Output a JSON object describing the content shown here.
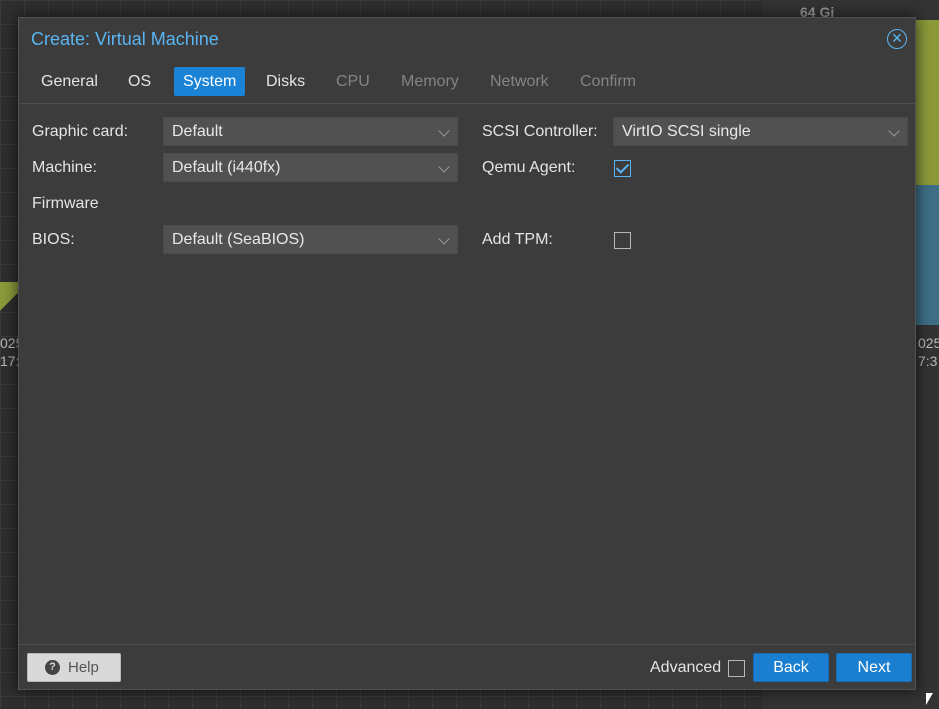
{
  "background": {
    "top_label": "64 Gi",
    "left_year": [
      "025",
      "17:"
    ],
    "right_year": [
      "025",
      "7:3"
    ]
  },
  "dialog": {
    "title": "Create: Virtual Machine",
    "close_icon": "close-circle-icon"
  },
  "tabs": [
    {
      "label": "General",
      "state": "normal"
    },
    {
      "label": "OS",
      "state": "normal"
    },
    {
      "label": "System",
      "state": "active"
    },
    {
      "label": "Disks",
      "state": "normal"
    },
    {
      "label": "CPU",
      "state": "disabled"
    },
    {
      "label": "Memory",
      "state": "disabled"
    },
    {
      "label": "Network",
      "state": "disabled"
    },
    {
      "label": "Confirm",
      "state": "disabled"
    }
  ],
  "form": {
    "graphic_card": {
      "label": "Graphic card:",
      "value": "Default"
    },
    "machine": {
      "label": "Machine:",
      "value": "Default (i440fx)"
    },
    "firmware_heading": "Firmware",
    "bios": {
      "label": "BIOS:",
      "value": "Default (SeaBIOS)"
    },
    "scsi_controller": {
      "label": "SCSI Controller:",
      "value": "VirtIO SCSI single"
    },
    "qemu_agent": {
      "label": "Qemu Agent:",
      "checked": true
    },
    "add_tpm": {
      "label": "Add TPM:",
      "checked": false
    }
  },
  "footer": {
    "help_label": "Help",
    "advanced_label": "Advanced",
    "advanced_checked": false,
    "back_label": "Back",
    "next_label": "Next"
  },
  "colors": {
    "accent": "#1a83d6",
    "title": "#5ab4f1",
    "dialog_bg": "#3c3c3c"
  }
}
